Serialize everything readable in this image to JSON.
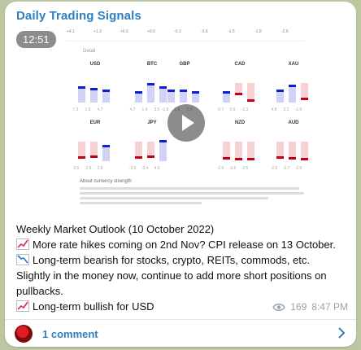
{
  "channel": {
    "title": "Daily Trading Signals"
  },
  "video": {
    "duration": "12:51"
  },
  "screenshot": {
    "strip_values": [
      "+4.1",
      "+1.3",
      "+6.6",
      "+0.6",
      "-0.3",
      "-3.6",
      "-1.5",
      "-1.8",
      "-2.6"
    ],
    "section_label": "Detail",
    "currencies": [
      {
        "code": "USD",
        "tone": "blue",
        "marks": [
          0.4,
          0.45,
          0.5
        ],
        "captions": [
          "7.3",
          "1.6",
          "4.7"
        ]
      },
      {
        "code": "BTC",
        "tone": "blue",
        "marks": [
          0.55,
          0.3,
          0.4
        ],
        "captions": [
          "4.7",
          "1.4",
          "3.5"
        ]
      },
      {
        "code": "GBP",
        "tone": "mixed",
        "marks": [
          0.5,
          0.5,
          0.55
        ],
        "captions": [
          "-1.8",
          "1.6",
          "2.4"
        ]
      },
      {
        "code": "CAD",
        "tone": "red",
        "marks": [
          0.55,
          0.6,
          0.8
        ],
        "captions": [
          "-0.7",
          "0.9",
          "-2.3"
        ]
      },
      {
        "code": "XAU",
        "tone": "mixed",
        "marks": [
          0.5,
          0.35,
          0.75
        ],
        "captions": [
          "4.8",
          "3.2",
          "-1.6"
        ]
      },
      {
        "code": "EUR",
        "tone": "mixed",
        "marks": [
          0.75,
          0.72,
          0.4
        ],
        "captions": [
          "-3.5",
          "-2.8",
          "2.8"
        ]
      },
      {
        "code": "JPY",
        "tone": "mixed",
        "marks": [
          0.75,
          0.72,
          0.25
        ],
        "captions": [
          "-3.5",
          "-3.4",
          "4.5"
        ]
      },
      {
        "code": "NZD",
        "tone": "red",
        "marks": [
          0.78,
          0.8,
          0.8
        ],
        "captions": [
          "-2.6",
          "-3.5",
          "-2.5"
        ]
      },
      {
        "code": "AUD",
        "tone": "red",
        "marks": [
          0.75,
          0.78,
          0.8
        ],
        "captions": [
          "-2.5",
          "-2.7",
          "-2.5"
        ]
      }
    ],
    "about_title": "About currency strength"
  },
  "message": {
    "line1": "Weekly Market Outlook (10 October 2022)",
    "line2": "More rate hikes coming on 2nd Nov? CPI release on 13 October.",
    "line3": "Long-term bearish for stocks, crypto, REITs, commods, etc.",
    "line4": "Slightly in the money now, continue to add more short positions on",
    "line5": "pullbacks.",
    "line6": "Long-term bullish for USD",
    "icons": [
      "chart-increasing-icon",
      "chart-decreasing-icon",
      "chart-increasing-icon"
    ]
  },
  "meta": {
    "views": "169",
    "time": "8:47 PM"
  },
  "footer": {
    "comments": "1 comment"
  },
  "colors": {
    "accent": "#2f7fc1",
    "blue_bar": "#0b1fd1",
    "red_bar": "#c0001a",
    "bg": "#bcc7a2"
  }
}
